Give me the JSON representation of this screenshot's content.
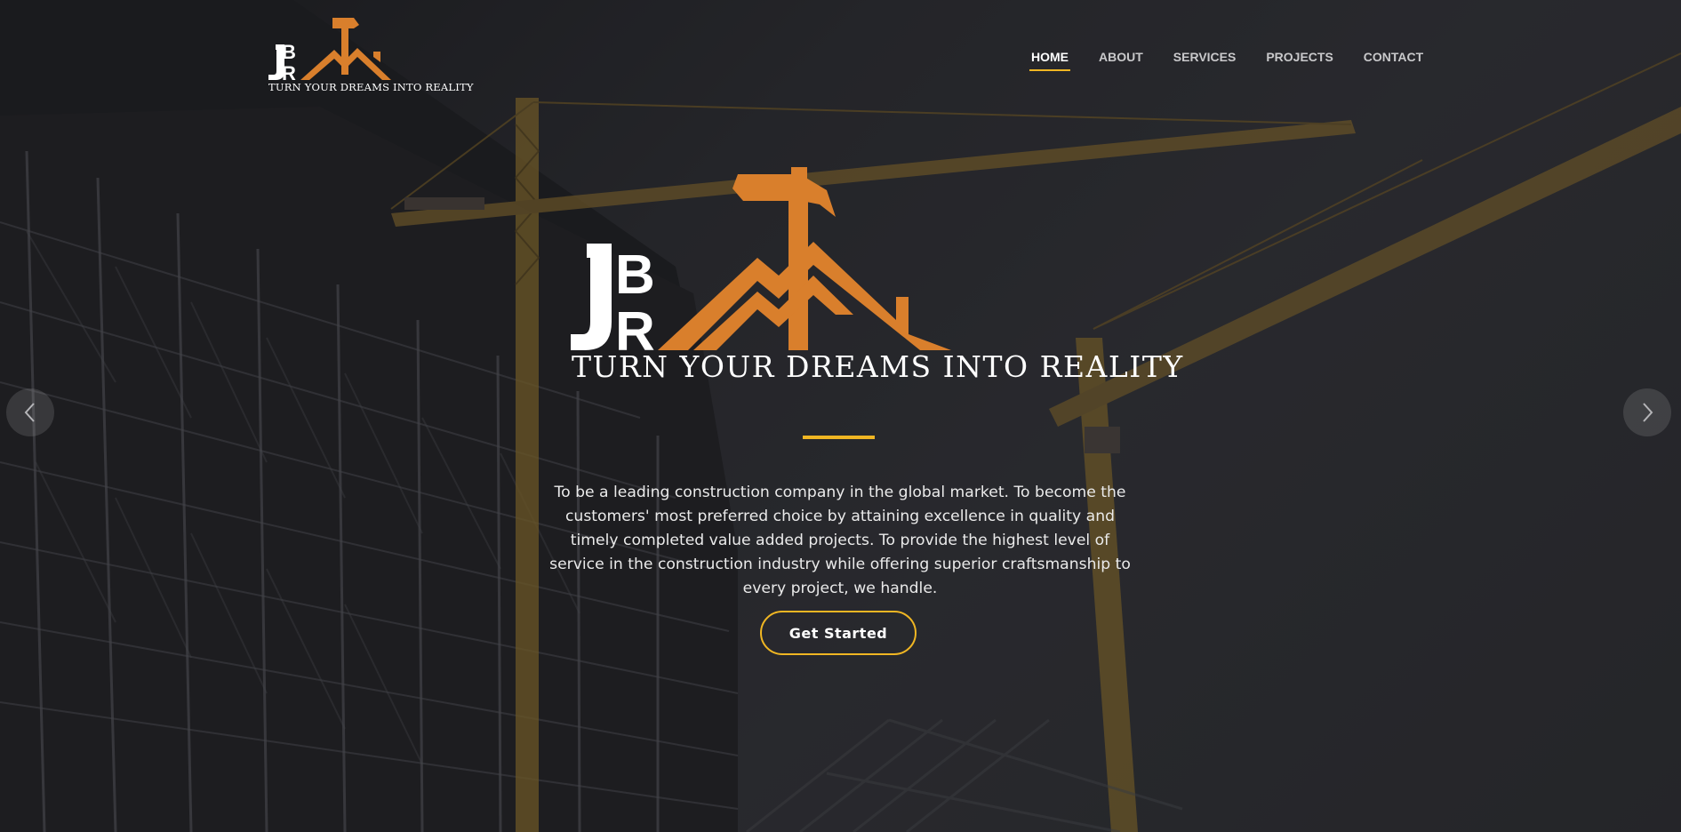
{
  "brand": {
    "logo_letters": "JBR",
    "tagline": "TURN YOUR DREAMS INTO REALITY",
    "accent_color": "#d97f2c"
  },
  "nav": {
    "items": [
      {
        "label": "HOME",
        "active": true
      },
      {
        "label": "ABOUT",
        "active": false
      },
      {
        "label": "SERVICES",
        "active": false
      },
      {
        "label": "PROJECTS",
        "active": false
      },
      {
        "label": "CONTACT",
        "active": false
      }
    ],
    "active_underline_color": "#f0b623"
  },
  "hero": {
    "tagline": "TURN YOUR DREAMS INTO REALITY",
    "mission": "To be a leading construction company in the global market. To become the customers' most preferred choice by attaining excellence in quality and timely completed value added projects. To provide the highest level of service in the construction industry while offering superior craftsmanship to every project, we handle.",
    "cta_label": "Get Started",
    "cta_border_color": "#f0b623"
  },
  "carousel": {
    "prev_icon": "chevron-left-icon",
    "next_icon": "chevron-right-icon"
  }
}
